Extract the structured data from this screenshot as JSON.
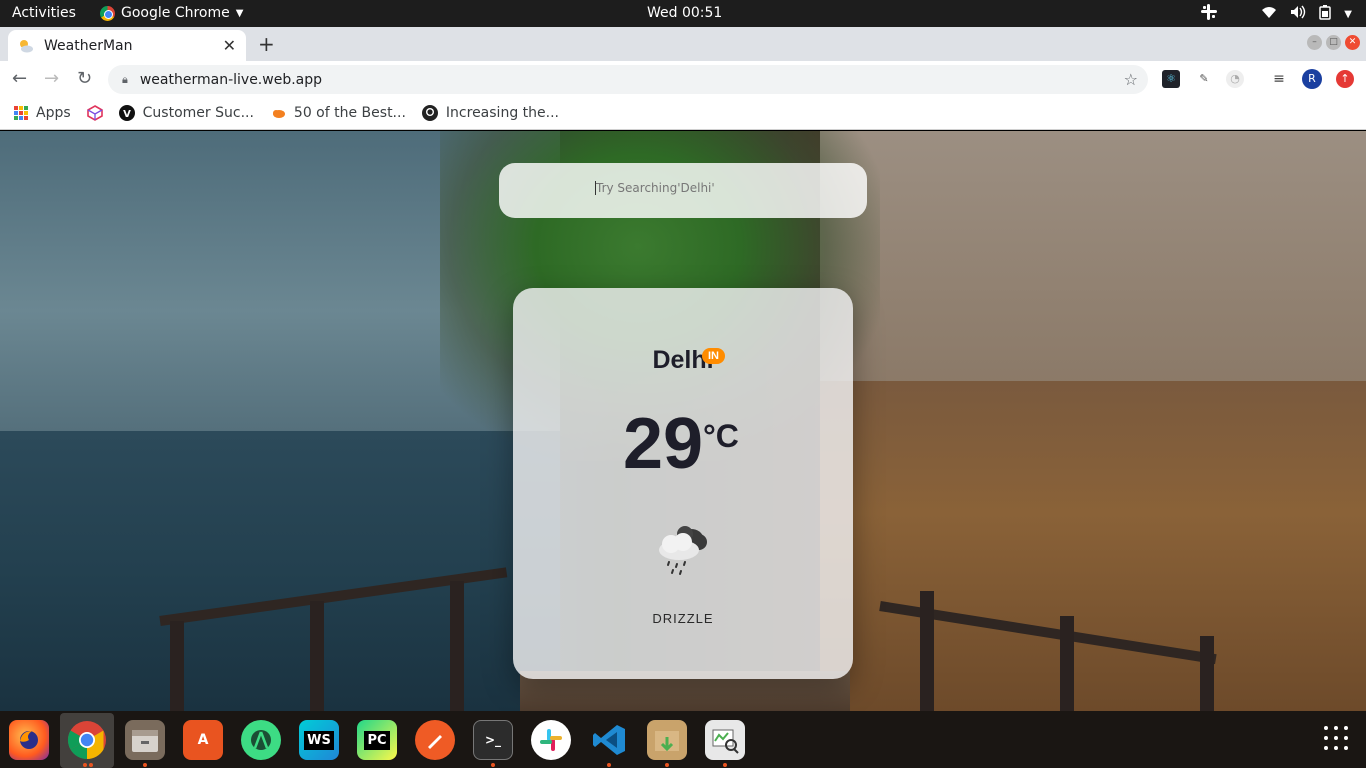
{
  "system": {
    "activities": "Activities",
    "app_name": "Google Chrome",
    "clock": "Wed 00:51"
  },
  "browser": {
    "tab_title": "WeatherMan",
    "url": "weatherman-live.web.app",
    "bookmarks": [
      {
        "label": "Apps"
      },
      {
        "label": ""
      },
      {
        "label": "Customer Suc..."
      },
      {
        "label": "50 of the Best..."
      },
      {
        "label": "Increasing the..."
      }
    ],
    "profile_initial": "R"
  },
  "weather": {
    "search_placeholder": "Try Searching'Delhi'",
    "city": "Delhi",
    "country_code": "IN",
    "temperature": "29",
    "unit": "°C",
    "condition": "DRIZZLE",
    "icon": "drizzle-cloud-icon"
  },
  "colors": {
    "badge": "#ff8c00",
    "text_dark": "#1e1e2a"
  }
}
